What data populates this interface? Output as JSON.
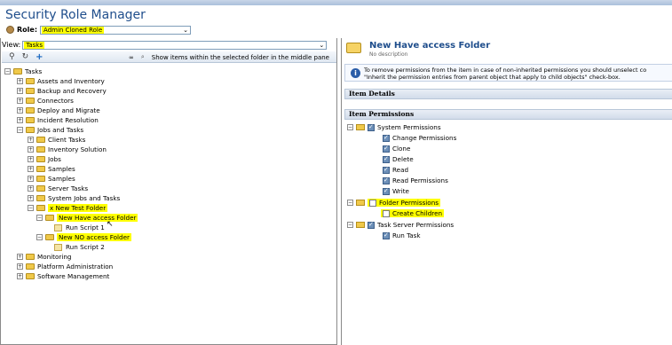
{
  "app_title": "Security Role Manager",
  "role": {
    "label": "Role:",
    "value": "Admin Cloned Role"
  },
  "view": {
    "label": "View:",
    "value": "Tasks"
  },
  "toolbar": {
    "show_items_text": "Show items within the selected folder in the middle pane"
  },
  "tree": {
    "root": "Tasks",
    "items": [
      "Assets and Inventory",
      "Backup and Recovery",
      "Connectors",
      "Deploy and Migrate",
      "Incident Resolution",
      "Jobs and Tasks",
      "Client Tasks",
      "Inventory Solution",
      "Jobs",
      "Samples",
      "Samples",
      "Server Tasks",
      "System Jobs and Tasks",
      "x New Test Folder",
      "New Have access Folder",
      "Run Script 1",
      "New NO access Folder",
      "Run Script 2",
      "Monitoring",
      "Platform Administration",
      "Software Management"
    ]
  },
  "details": {
    "title": "New Have access Folder",
    "subtitle": "No description",
    "info_line1": "To remove permissions from the item in case of non-inherited permissions you should unselect co",
    "info_line2": "\"Inherit the permission entries from parent object that apply to child objects\" check-box.",
    "item_details_header": "Item Details",
    "item_permissions_header": "Item Permissions"
  },
  "permissions": {
    "system": {
      "label": "System Permissions",
      "items": [
        "Change Permissions",
        "Clone",
        "Delete",
        "Read",
        "Read Permissions",
        "Write"
      ]
    },
    "folder": {
      "label": "Folder Permissions",
      "items": [
        "Create Children"
      ]
    },
    "task_server": {
      "label": "Task Server Permissions",
      "items": [
        "Run Task"
      ]
    }
  },
  "colors": {
    "highlight": "#ffff00",
    "title_blue": "#1f4e8c"
  }
}
